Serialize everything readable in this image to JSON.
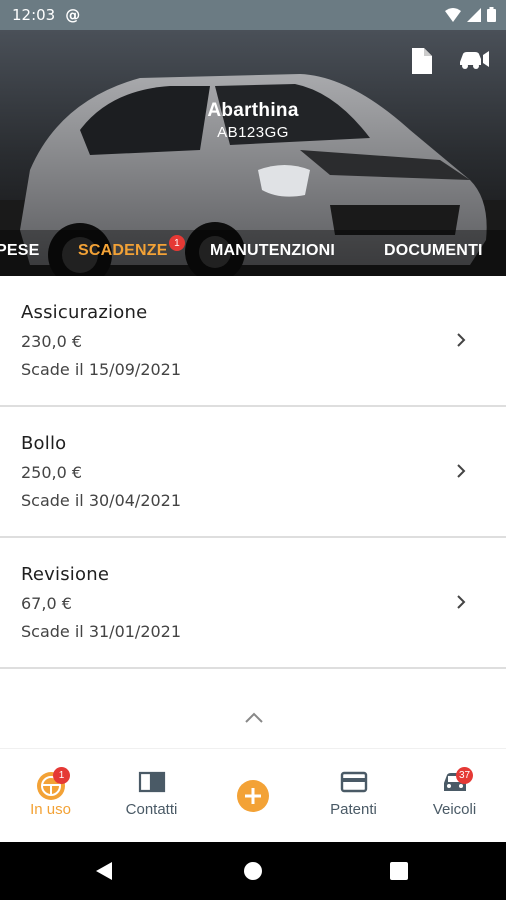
{
  "status_bar": {
    "time": "12:03"
  },
  "vehicle": {
    "name": "Abarthina",
    "plate": "AB123GG"
  },
  "tabs": [
    {
      "label": "PESE"
    },
    {
      "label": "SCADENZE",
      "badge": "1"
    },
    {
      "label": "MANUTENZIONI"
    },
    {
      "label": "DOCUMENTI"
    }
  ],
  "deadlines": [
    {
      "title": "Assicurazione",
      "amount": "230,0 €",
      "due": "Scade il 15/09/2021"
    },
    {
      "title": "Bollo",
      "amount": "250,0 €",
      "due": "Scade il 30/04/2021"
    },
    {
      "title": "Revisione",
      "amount": "67,0 €",
      "due": "Scade il 31/01/2021"
    }
  ],
  "bottom_nav": [
    {
      "label": "In uso",
      "badge": "1"
    },
    {
      "label": "Contatti"
    },
    {
      "label": ""
    },
    {
      "label": "Patenti"
    },
    {
      "label": "Veicoli",
      "badge": "37"
    }
  ],
  "colors": {
    "accent": "#f3a236",
    "badge": "#e53935",
    "nav_text": "#4a5a66"
  },
  "icons": {
    "hero_actions": [
      "document-icon",
      "car-sound-icon"
    ],
    "bottom_nav": [
      "steering-wheel-icon",
      "book-icon",
      "add-circle-icon",
      "card-icon",
      "car-icon"
    ]
  }
}
